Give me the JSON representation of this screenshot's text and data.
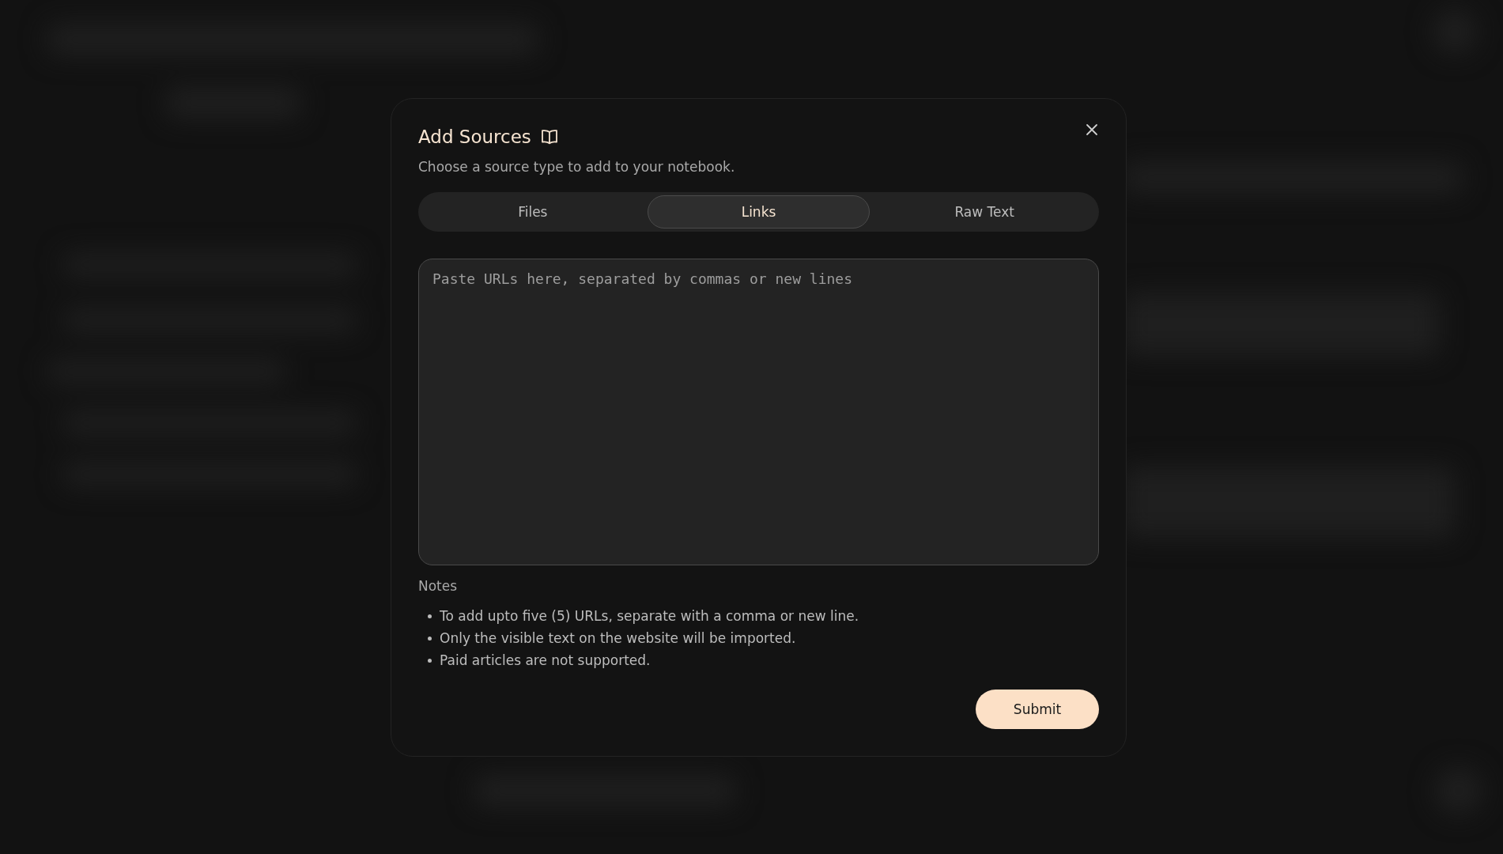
{
  "dialog": {
    "title": "Add Sources",
    "subtitle": "Choose a source type to add to your notebook.",
    "tabs": [
      {
        "label": "Files",
        "selected": false
      },
      {
        "label": "Links",
        "selected": true
      },
      {
        "label": "Raw Text",
        "selected": false
      }
    ],
    "url_field": {
      "placeholder": "Paste URLs here, separated by commas or new lines"
    },
    "notes": {
      "heading": "Notes",
      "items": [
        "To add upto five (5) URLs, separate with a comma or new line.",
        "Only the visible text on the website will be imported.",
        "Paid articles are not supported."
      ]
    },
    "submit_button": "Submit"
  }
}
